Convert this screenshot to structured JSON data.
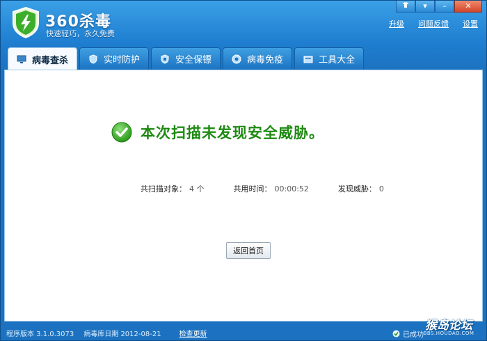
{
  "app": {
    "name": "360杀毒",
    "slogan": "快速轻巧，永久免费"
  },
  "window_controls": {
    "menu": "▾",
    "minimize": "–",
    "close": "✕"
  },
  "top_links": {
    "upgrade": "升级",
    "feedback": "问题反馈",
    "settings": "设置"
  },
  "tabs": [
    {
      "label": "病毒查杀",
      "icon": "monitor-icon",
      "active": true
    },
    {
      "label": "实时防护",
      "icon": "shield-icon",
      "active": false
    },
    {
      "label": "安全保镖",
      "icon": "shield-icon",
      "active": false
    },
    {
      "label": "病毒免疫",
      "icon": "globe-icon",
      "active": false
    },
    {
      "label": "工具大全",
      "icon": "toolbox-icon",
      "active": false
    }
  ],
  "result": {
    "message": "本次扫描未发现安全威胁。",
    "icon": "check-icon",
    "color": "#1e8a12"
  },
  "stats": {
    "scanned_label": "共扫描对象：",
    "scanned_value": "4 个",
    "time_label": "共用时间：",
    "time_value": "00:00:52",
    "threats_label": "发现威胁：",
    "threats_value": "0"
  },
  "home_button": "返回首页",
  "status_bar": {
    "version": "程序版本 3.1.0.3073",
    "db_date": "病毒库日期 2012-08-21",
    "check_update": "检查更新",
    "status_text": "已成功"
  },
  "watermark": {
    "main": "猴岛论坛",
    "url": "BBS.HOUDAO.COM"
  }
}
